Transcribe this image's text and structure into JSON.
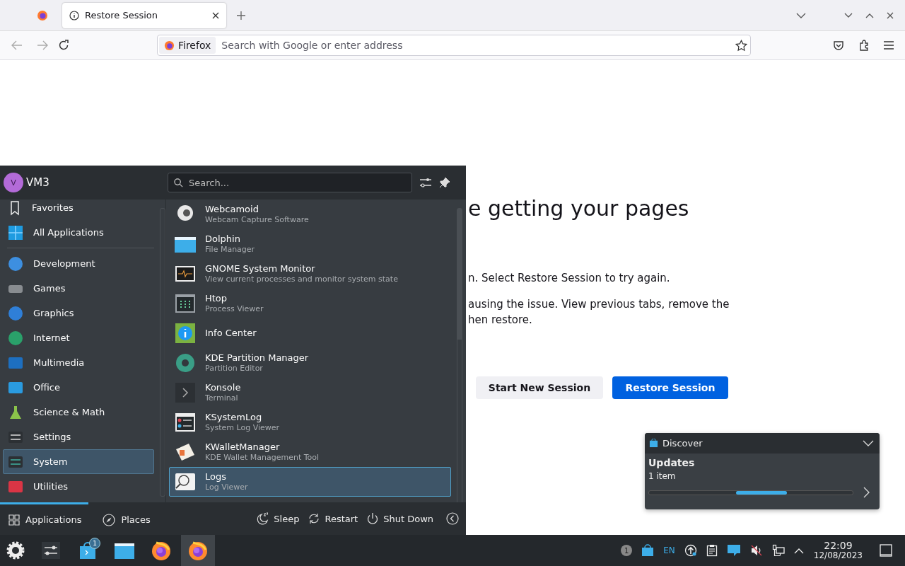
{
  "browser": {
    "tabs": [
      {
        "kind": "pinned",
        "selected": false
      },
      {
        "kind": "normal",
        "label": "Restore Session",
        "selected": true
      }
    ],
    "url_bar": {
      "identity": "Firefox",
      "placeholder": "Search with Google or enter address"
    }
  },
  "page": {
    "heading": "e getting your pages",
    "lines": [
      "n. Select Restore Session to try again.",
      "ausing the issue. View previous tabs, remove the",
      "hen restore."
    ],
    "buttons": [
      {
        "label": "Start New Session",
        "kind": "secondary"
      },
      {
        "label": "Restore Session",
        "kind": "primary"
      }
    ]
  },
  "launcher": {
    "user": {
      "initial": "V",
      "name": "VM3"
    },
    "search": {
      "placeholder": "Search..."
    },
    "places": [
      {
        "label": "Favorites",
        "selected": false
      },
      {
        "label": "All Applications",
        "selected": false
      }
    ],
    "categories": [
      {
        "label": "Development",
        "selected": false
      },
      {
        "label": "Games",
        "selected": false
      },
      {
        "label": "Graphics",
        "selected": false
      },
      {
        "label": "Internet",
        "selected": false
      },
      {
        "label": "Multimedia",
        "selected": false
      },
      {
        "label": "Office",
        "selected": false
      },
      {
        "label": "Science & Math",
        "selected": false
      },
      {
        "label": "Settings",
        "selected": false
      },
      {
        "label": "System",
        "selected": true
      },
      {
        "label": "Utilities",
        "selected": false
      }
    ],
    "apps": [
      {
        "name": "Webcamoid",
        "description": "Webcam Capture Software",
        "selected": false
      },
      {
        "name": "Dolphin",
        "description": "File Manager",
        "selected": false
      },
      {
        "name": "GNOME System Monitor",
        "description": "View current processes and monitor system state",
        "selected": false
      },
      {
        "name": "Htop",
        "description": "Process Viewer",
        "selected": false
      },
      {
        "name": "Info Center",
        "selected": false
      },
      {
        "name": "KDE Partition Manager",
        "description": "Partition Editor",
        "selected": false
      },
      {
        "name": "Konsole",
        "description": "Terminal",
        "selected": false
      },
      {
        "name": "KSystemLog",
        "description": "System Log Viewer",
        "selected": false
      },
      {
        "name": "KWalletManager",
        "description": "KDE Wallet Management Tool",
        "selected": false
      },
      {
        "name": "Logs",
        "description": "Log Viewer",
        "selected": true
      }
    ],
    "tabs": [
      {
        "label": "Applications",
        "selected": true
      },
      {
        "label": "Places",
        "selected": false
      }
    ],
    "actions": [
      {
        "kind": "sleep",
        "label": "Sleep"
      },
      {
        "kind": "restart",
        "label": "Restart"
      },
      {
        "kind": "shutdown",
        "label": "Shut Down"
      }
    ]
  },
  "notification": {
    "app": "Discover",
    "title": "Updates",
    "body": "1 item"
  },
  "taskbar": {
    "apps": [
      {
        "kind": "launcher",
        "selected": false
      },
      {
        "kind": "settings",
        "selected": false
      },
      {
        "kind": "store",
        "selected": false,
        "badge": "1"
      },
      {
        "kind": "folder",
        "selected": false
      },
      {
        "kind": "browser",
        "selected": false
      },
      {
        "kind": "browser",
        "selected": true
      }
    ],
    "tray": [
      {
        "kind": "count",
        "label": "1"
      },
      {
        "kind": "store"
      },
      {
        "kind": "language",
        "label": "EN"
      },
      {
        "kind": "update"
      },
      {
        "kind": "clipboard"
      },
      {
        "kind": "chat"
      },
      {
        "kind": "mute"
      },
      {
        "kind": "network"
      },
      {
        "kind": "caret"
      }
    ],
    "clock": {
      "time": "22:09",
      "date": "12/08/2023"
    }
  }
}
